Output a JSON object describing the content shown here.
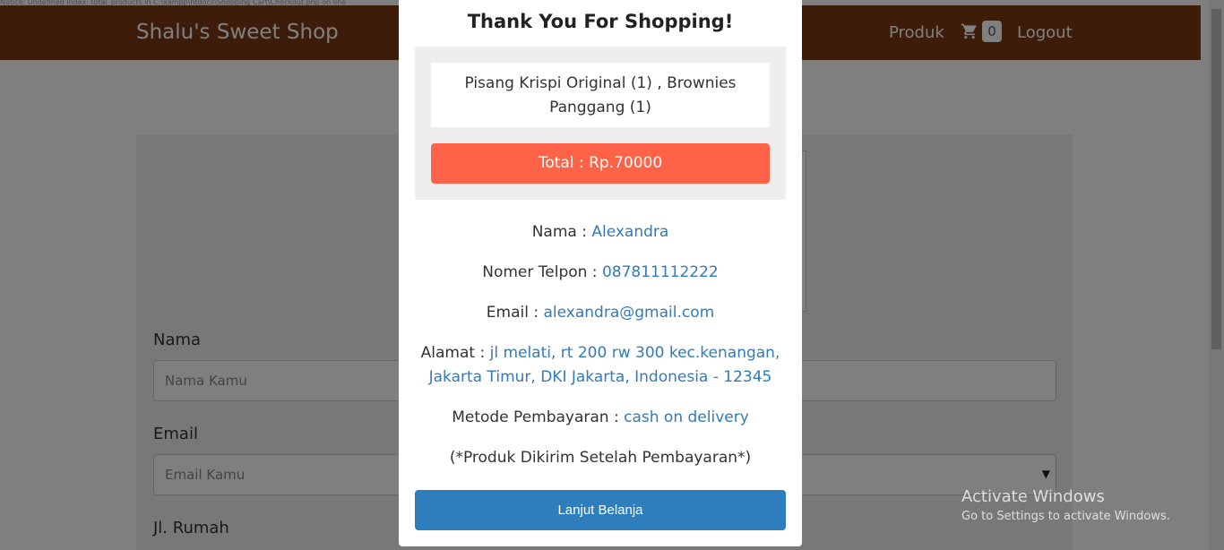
{
  "notice": "Notice: Undefined index: total_products in C:\\xampp\\htdocs\\Shopping Cart\\Checkout.php on line",
  "navbar": {
    "brand": "Shalu's Sweet Shop",
    "produk": "Produk",
    "cart_count": "0",
    "logout": "Logout"
  },
  "form": {
    "nama_label": "Nama",
    "nama_placeholder": "Nama Kamu",
    "email_label": "Email",
    "email_placeholder": "Email Kamu",
    "rumah_label": "Jl. Rumah"
  },
  "modal": {
    "title": "Thank You For Shopping!",
    "items": "Pisang Krispi Original (1) , Brownies Panggang (1)",
    "total": "Total : Rp.70000",
    "nama_label": "Nama :",
    "nama_value": "Alexandra",
    "telp_label": "Nomer Telpon :",
    "telp_value": "087811112222",
    "email_label": "Email :",
    "email_value": "alexandra@gmail.com",
    "alamat_label": "Alamat :",
    "alamat_value": "jl melati, rt 200 rw 300 kec.kenangan, Jakarta Timur, DKI Jakarta, Indonesia - 12345",
    "metode_label": "Metode Pembayaran :",
    "metode_value": "cash on delivery",
    "note": "(*Produk Dikirim Setelah Pembayaran*)",
    "button": "Lanjut Belanja"
  },
  "watermark": {
    "title": "Activate Windows",
    "subtitle": "Go to Settings to activate Windows."
  },
  "colors": {
    "navbar": "#7a3a12",
    "total_bar": "#ff6347",
    "button": "#2e7ebd",
    "value_text": "#337ab7"
  }
}
